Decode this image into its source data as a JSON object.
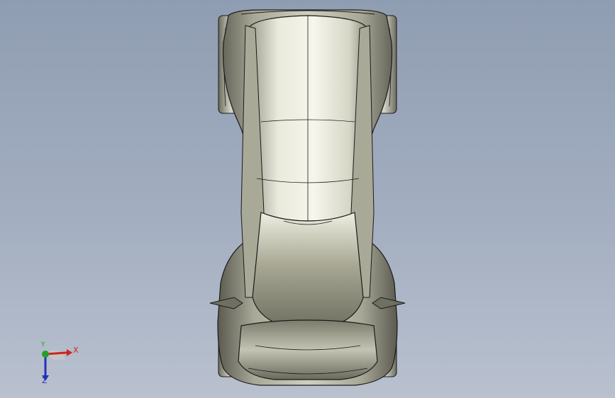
{
  "viewport": {
    "background_top": "#8f9db2",
    "background_bottom": "#b9c1cf"
  },
  "model": {
    "subject": "car-top-view",
    "body_color": "#8f8f7f",
    "highlight_color": "#f4f4e8",
    "edge_color": "#1a1a1a"
  },
  "triad": {
    "x_label": "X",
    "y_label": "Y",
    "z_label": "Z",
    "x_color": "#d0241e",
    "y_color": "#22a02a",
    "z_color": "#2333b8"
  }
}
